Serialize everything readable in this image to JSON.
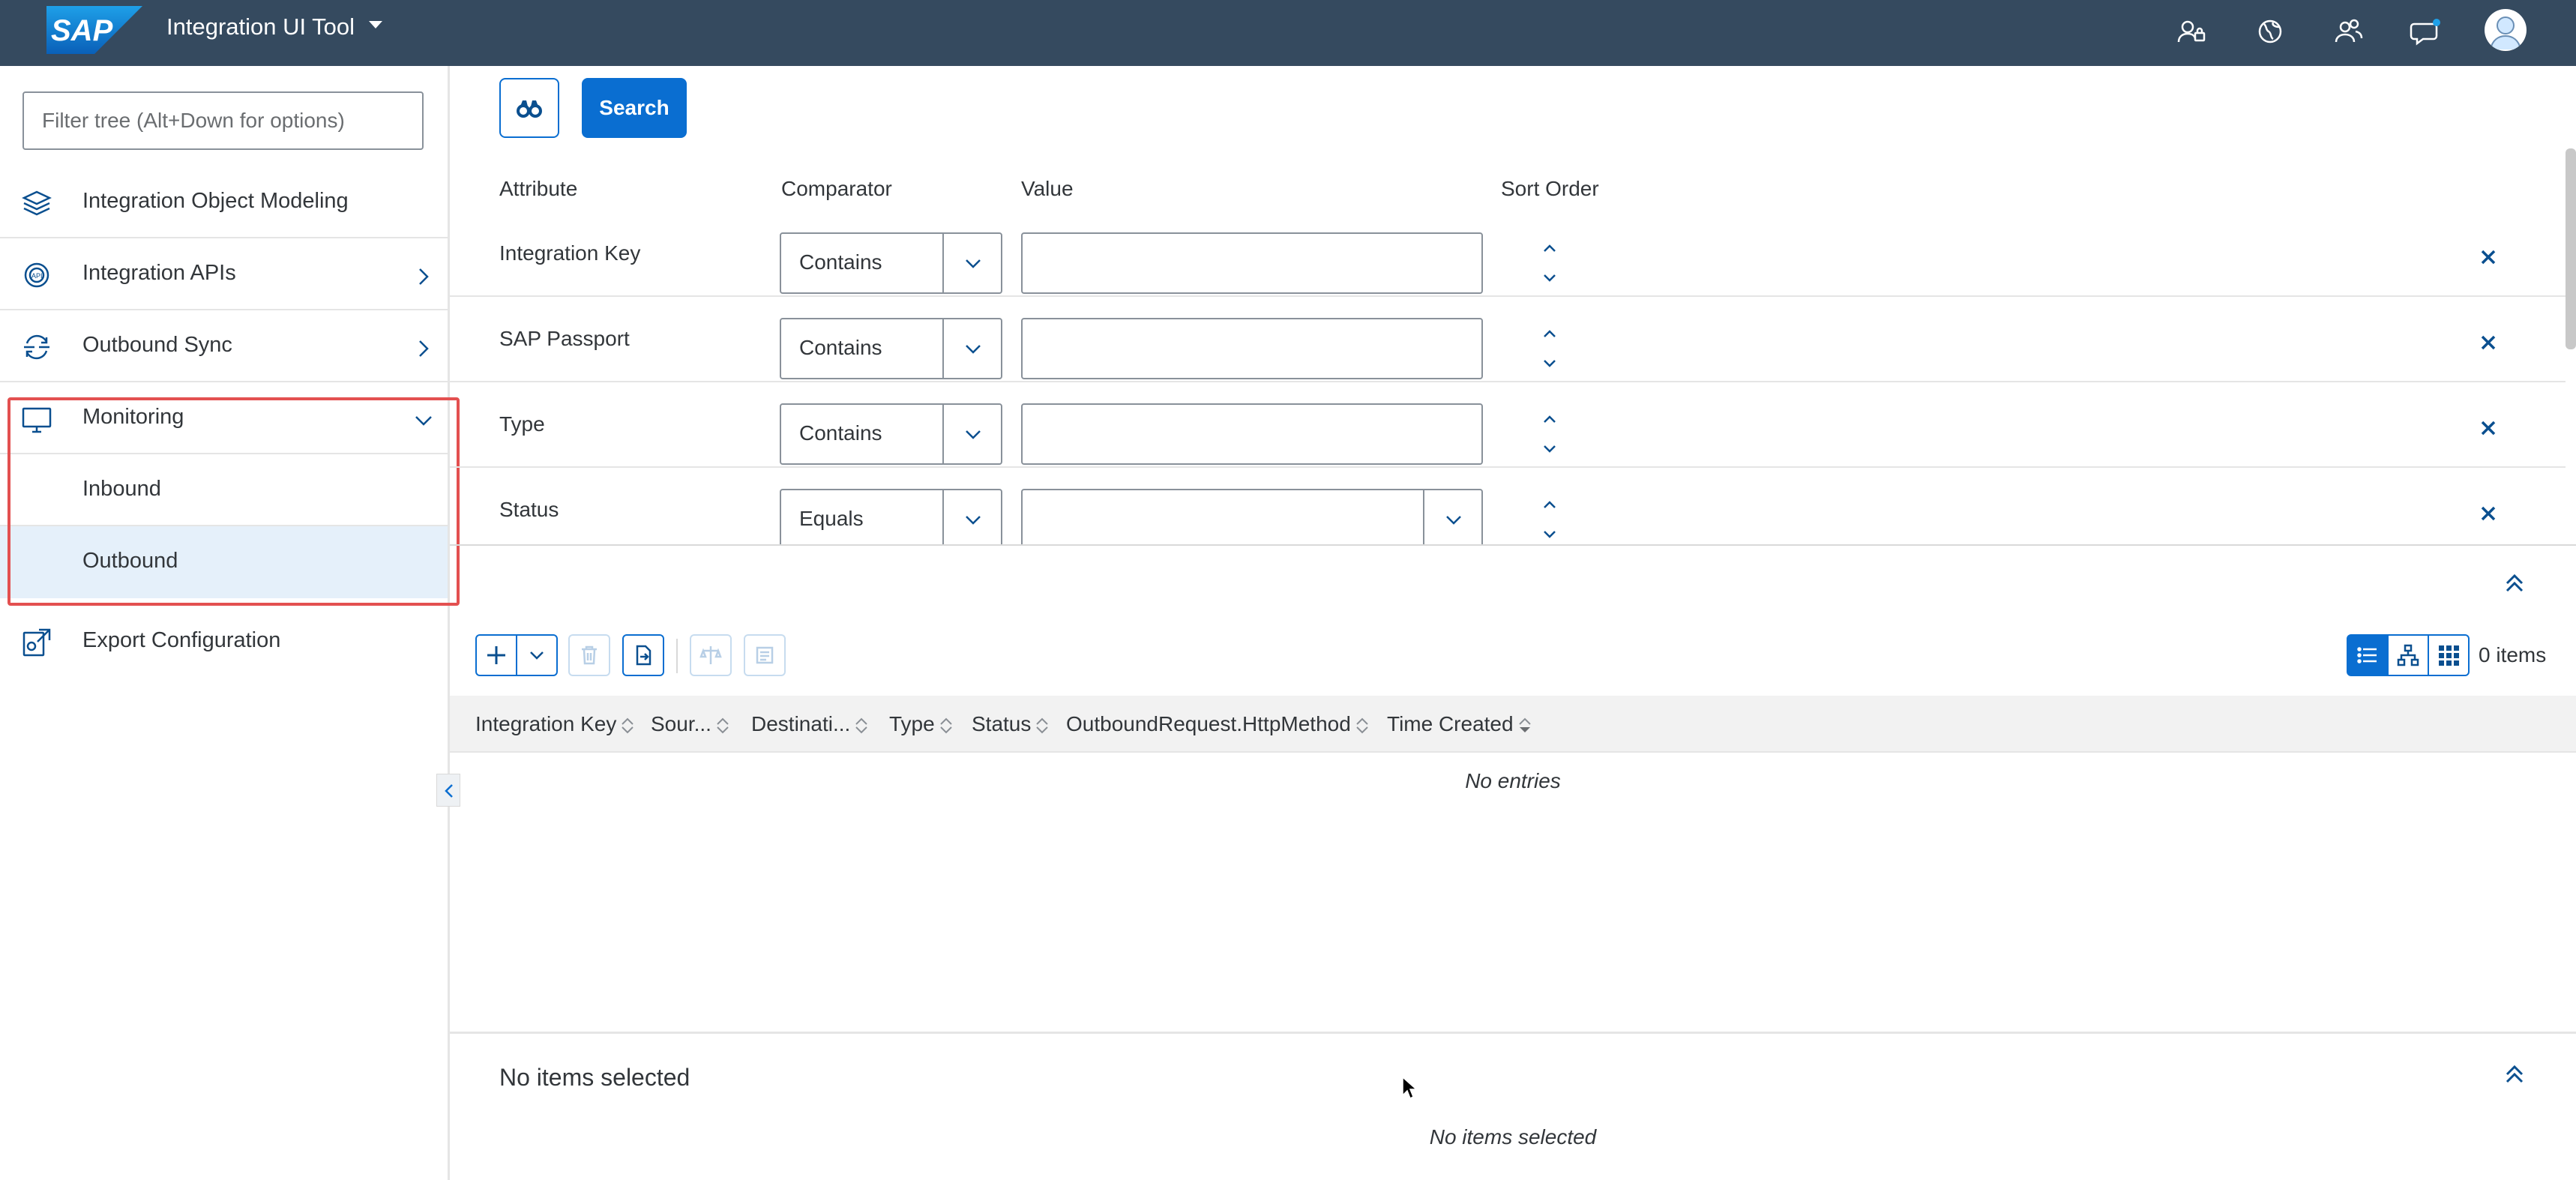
{
  "shell": {
    "logo_text": "SAP",
    "app_title": "Integration UI Tool",
    "icons": [
      "user-lock-icon",
      "globe-icon",
      "user-group-icon",
      "feedback-icon"
    ],
    "avatar": "user-avatar-icon"
  },
  "sidebar": {
    "filter_placeholder": "Filter tree (Alt+Down for options)",
    "items": [
      {
        "label": "Integration Object Modeling",
        "icon": "layers-icon",
        "chevron": ""
      },
      {
        "label": "Integration APIs",
        "icon": "api-icon",
        "chevron": "chevron-right"
      },
      {
        "label": "Outbound Sync",
        "icon": "sync-icon",
        "chevron": "chevron-right"
      },
      {
        "label": "Monitoring",
        "icon": "monitor-icon",
        "chevron": "chevron-down"
      },
      {
        "label": "Export Configuration",
        "icon": "export-config-icon",
        "chevron": ""
      }
    ],
    "monitoring_children": [
      {
        "label": "Inbound",
        "selected": false
      },
      {
        "label": "Outbound",
        "selected": true
      }
    ]
  },
  "search": {
    "button_label": "Search",
    "columns": {
      "attribute": "Attribute",
      "comparator": "Comparator",
      "value": "Value",
      "sort_order": "Sort Order"
    },
    "rows": [
      {
        "attribute": "Integration Key",
        "comparator": "Contains",
        "value": ""
      },
      {
        "attribute": "SAP Passport",
        "comparator": "Contains",
        "value": ""
      },
      {
        "attribute": "Type",
        "comparator": "Contains",
        "value": ""
      },
      {
        "attribute": "Status",
        "comparator": "Equals",
        "value": ""
      }
    ]
  },
  "results": {
    "items_count": "0 items",
    "columns": [
      "Integration Key",
      "Sour...",
      "Destinati...",
      "Type",
      "Status",
      "OutboundRequest.HttpMethod",
      "Time Created"
    ],
    "empty_text": "No entries"
  },
  "details": {
    "title": "No items selected",
    "empty_text": "No items selected"
  },
  "colors": {
    "shell_bg": "#354a5f",
    "accent": "#0a6ed1",
    "selection_bg": "#e5f0fa",
    "highlight_border": "#e35050"
  }
}
